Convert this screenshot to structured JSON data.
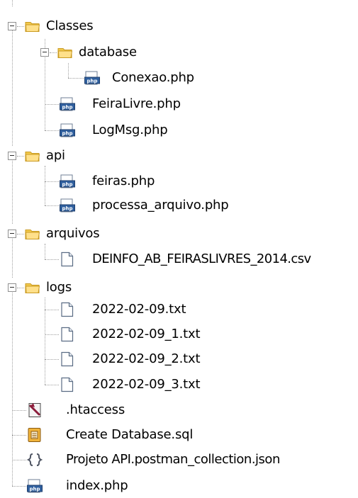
{
  "tree": {
    "classes": {
      "label": "Classes",
      "database": {
        "label": "database",
        "conexao": "Conexao.php"
      },
      "feiralivre": "FeiraLivre.php",
      "logmsg": "LogMsg.php"
    },
    "api": {
      "label": "api",
      "feiras": "feiras.php",
      "processa_arquivo": "processa_arquivo.php"
    },
    "arquivos": {
      "label": "arquivos",
      "csv": "DEINFO_AB_FEIRASLIVRES_2014.csv"
    },
    "logs": {
      "label": "logs",
      "files": [
        "2022-02-09.txt",
        "2022-02-09_1.txt",
        "2022-02-09_2.txt",
        "2022-02-09_3.txt"
      ]
    },
    "htaccess": ".htaccess",
    "create_sql": "Create Database.sql",
    "postman": "Projeto API.postman_collection.json",
    "index": "index.php"
  },
  "icon_names": {
    "folder": "folder-icon",
    "php": "php-file-icon",
    "text": "text-file-icon",
    "htaccess": "htaccess-file-icon",
    "sql": "sql-file-icon",
    "json": "json-file-icon"
  },
  "colors": {
    "folder": "#f7d46a",
    "tree_lines": "#a0a0a0",
    "php_icon": "#2f5f9e"
  }
}
